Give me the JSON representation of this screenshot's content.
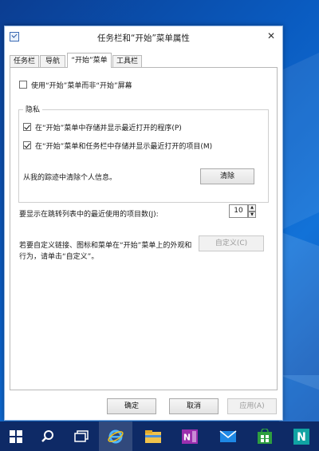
{
  "window": {
    "title": "任务栏和“开始”菜单属性",
    "close_glyph": "✕"
  },
  "tabs": [
    {
      "label": "任务栏"
    },
    {
      "label": "导航"
    },
    {
      "label": "“开始”菜单",
      "active": true
    },
    {
      "label": "工具栏"
    }
  ],
  "start_menu": {
    "use_start_menu_label": "使用“开始”菜单而非“开始”屏幕",
    "use_start_menu_checked": false
  },
  "privacy": {
    "title": "隐私",
    "store_programs_label": "在“开始”菜单中存储并显示最近打开的程序(P)",
    "store_programs_checked": true,
    "store_items_label": "在“开始”菜单和任务栏中存储并显示最近打开的项目(M)",
    "store_items_checked": true,
    "clear_text": "从我的踪迹中清除个人信息。",
    "clear_button": "清除"
  },
  "jump_list": {
    "label": "要显示在跳转列表中的最近使用的项目数(J):",
    "value": "10"
  },
  "customize": {
    "description_line1": "若要自定义链接、图标和菜单在“开始”菜单上的外观和",
    "description_line2": "行为，请单击“自定义”。",
    "button": "自定义(C)"
  },
  "footer": {
    "ok": "确定",
    "cancel": "取消",
    "apply": "应用(A)"
  },
  "taskbar": {
    "items": [
      "windows-start-icon",
      "search-icon",
      "task-view-icon",
      "internet-explorer-icon",
      "file-explorer-icon",
      "onenote-icon",
      "mail-icon",
      "store-icon",
      "news-icon"
    ],
    "onenote_letter": "N",
    "news_letter": "N"
  },
  "colors": {
    "taskbar": "#0e2a66",
    "desktop": "#0a5bc0",
    "accent": "#1f4f9e"
  }
}
